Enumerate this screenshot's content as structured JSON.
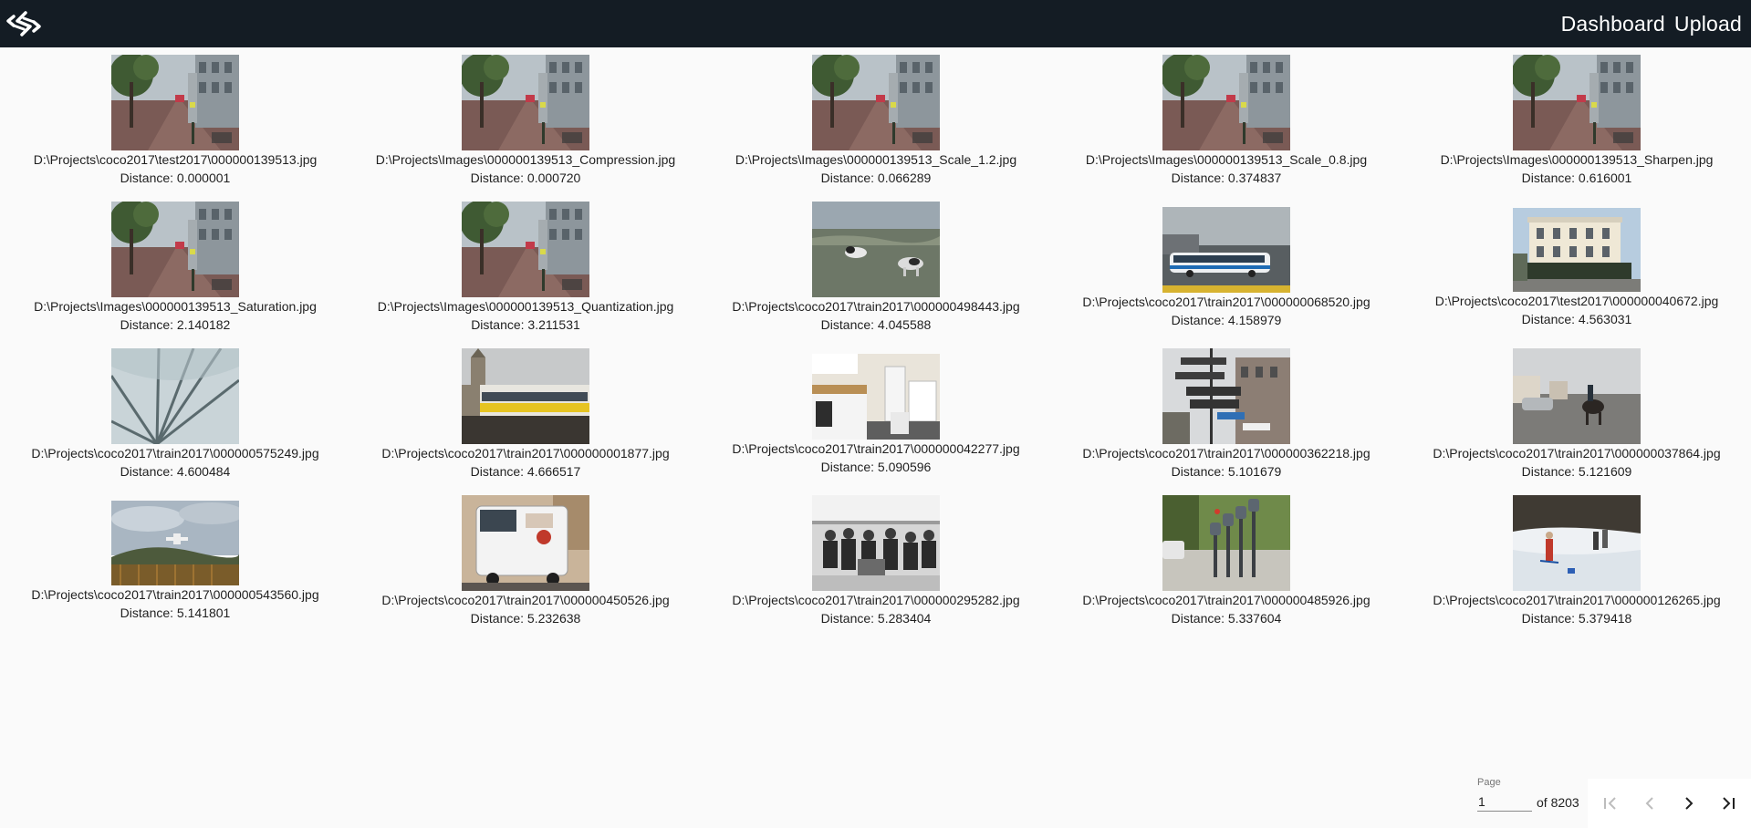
{
  "header": {
    "nav": [
      "Dashboard",
      "Upload"
    ]
  },
  "results": [
    {
      "path": "D:\\Projects\\coco2017\\test2017\\000000139513.jpg",
      "distance": "Distance: 0.000001",
      "scene": "street"
    },
    {
      "path": "D:\\Projects\\Images\\000000139513_Compression.jpg",
      "distance": "Distance: 0.000720",
      "scene": "street"
    },
    {
      "path": "D:\\Projects\\Images\\000000139513_Scale_1.2.jpg",
      "distance": "Distance: 0.066289",
      "scene": "street"
    },
    {
      "path": "D:\\Projects\\Images\\000000139513_Scale_0.8.jpg",
      "distance": "Distance: 0.374837",
      "scene": "street"
    },
    {
      "path": "D:\\Projects\\Images\\000000139513_Sharpen.jpg",
      "distance": "Distance: 0.616001",
      "scene": "street"
    },
    {
      "path": "D:\\Projects\\Images\\000000139513_Saturation.jpg",
      "distance": "Distance: 2.140182",
      "scene": "street"
    },
    {
      "path": "D:\\Projects\\Images\\000000139513_Quantization.jpg",
      "distance": "Distance: 3.211531",
      "scene": "street"
    },
    {
      "path": "D:\\Projects\\coco2017\\train2017\\000000498443.jpg",
      "distance": "Distance: 4.045588",
      "scene": "dogs-beach"
    },
    {
      "path": "D:\\Projects\\coco2017\\train2017\\000000068520.jpg",
      "distance": "Distance: 4.158979",
      "scene": "bus"
    },
    {
      "path": "D:\\Projects\\coco2017\\test2017\\000000040672.jpg",
      "distance": "Distance: 4.563031",
      "scene": "building"
    },
    {
      "path": "D:\\Projects\\coco2017\\train2017\\000000575249.jpg",
      "distance": "Distance: 4.600484",
      "scene": "umbrella"
    },
    {
      "path": "D:\\Projects\\coco2017\\train2017\\000000001877.jpg",
      "distance": "Distance: 4.666517",
      "scene": "train"
    },
    {
      "path": "D:\\Projects\\coco2017\\train2017\\000000042277.jpg",
      "distance": "Distance: 5.090596",
      "scene": "kitchen"
    },
    {
      "path": "D:\\Projects\\coco2017\\train2017\\000000362218.jpg",
      "distance": "Distance: 5.101679",
      "scene": "signs"
    },
    {
      "path": "D:\\Projects\\coco2017\\train2017\\000000037864.jpg",
      "distance": "Distance: 5.121609",
      "scene": "horse"
    },
    {
      "path": "D:\\Projects\\coco2017\\train2017\\000000543560.jpg",
      "distance": "Distance: 5.141801",
      "scene": "airplane"
    },
    {
      "path": "D:\\Projects\\coco2017\\train2017\\000000450526.jpg",
      "distance": "Distance: 5.232638",
      "scene": "truck"
    },
    {
      "path": "D:\\Projects\\coco2017\\train2017\\000000295282.jpg",
      "distance": "Distance: 5.283404",
      "scene": "crowd"
    },
    {
      "path": "D:\\Projects\\coco2017\\train2017\\000000485926.jpg",
      "distance": "Distance: 5.337604",
      "scene": "parking-meters"
    },
    {
      "path": "D:\\Projects\\coco2017\\train2017\\000000126265.jpg",
      "distance": "Distance: 5.379418",
      "scene": "skiers"
    }
  ],
  "pagination": {
    "page_label": "Page",
    "page_value": "1",
    "of_label": "of 8203",
    "icons": [
      "first-page-icon",
      "previous-page-icon",
      "next-page-icon",
      "last-page-icon"
    ]
  },
  "colors": {
    "topbar": "#141c24",
    "background": "#fafafa",
    "disabled_icon": "#bdbdbd",
    "active_icon": "#212121"
  }
}
